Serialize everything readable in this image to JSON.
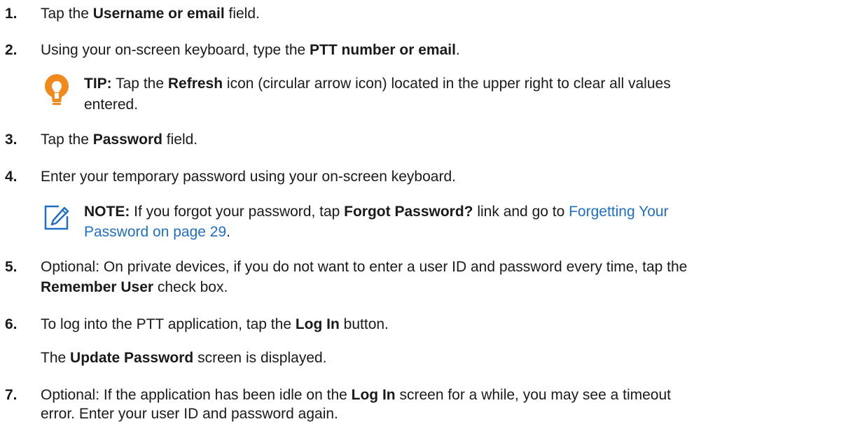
{
  "steps": [
    {
      "num": "1.",
      "pre": "Tap the ",
      "bold": "Username or email",
      "post": " field."
    },
    {
      "num": "2.",
      "pre": "Using your on-screen keyboard, type the ",
      "bold": "PTT number or email",
      "post": "."
    },
    {
      "num": "3.",
      "pre": "Tap the ",
      "bold": "Password",
      "post": " field."
    },
    {
      "num": "4.",
      "text": "Enter your temporary password using your on-screen keyboard."
    },
    {
      "num": "5.",
      "line1": "Optional: On private devices, if you do not want to enter a user ID and password every time, tap the",
      "bold": "Remember User",
      "post": " check box."
    },
    {
      "num": "6.",
      "pre": "To log into the PTT application, tap the ",
      "bold": "Log In",
      "post": " button.",
      "result_pre": "The ",
      "result_bold": "Update Password",
      "result_post": " screen is displayed."
    },
    {
      "num": "7.",
      "pre": "Optional: If the application has been idle on the ",
      "bold": "Log In",
      "post": " screen for a while, you may see a timeout",
      "line2": "error. Enter your user ID and password again."
    }
  ],
  "tip": {
    "label": "TIP:",
    "pre": " Tap the ",
    "bold": "Refresh",
    "post": " icon (circular arrow icon) located in the upper right to clear all values",
    "line2": "entered.",
    "icon": "lightbulb-icon",
    "color": "#f08a1c"
  },
  "note": {
    "label": "NOTE:",
    "pre": " If you forgot your password, tap ",
    "bold": "Forgot Password?",
    "mid": " link and go to ",
    "link1": "Forgetting Your",
    "link2": "Password on page 29",
    "end": ".",
    "icon": "pencil-note-icon",
    "color": "#1f6fc8"
  }
}
